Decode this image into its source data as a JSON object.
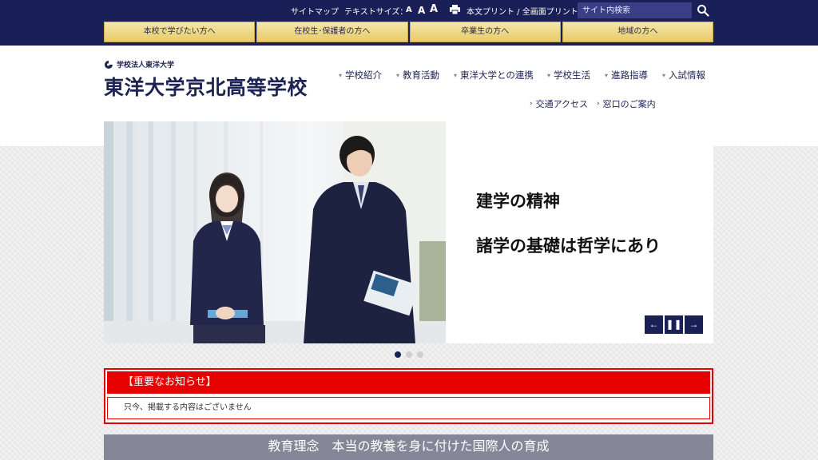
{
  "utility": {
    "sitemap": "サイトマップ",
    "text_size_label": "テキストサイズ：",
    "font_sizes": [
      "A",
      "A",
      "A"
    ],
    "print_label": "本文プリント / 全画面プリント",
    "search_placeholder": "サイト内検索"
  },
  "audience_nav": [
    "本校で学びたい方へ",
    "在校生･保護者の方へ",
    "卒業生の方へ",
    "地域の方へ"
  ],
  "header": {
    "corporation": "学校法人東洋大学",
    "school_name": "東洋大学京北高等学校"
  },
  "global_nav": [
    "学校紹介",
    "教育活動",
    "東洋大学との連携",
    "学校生活",
    "進路指導",
    "入試情報"
  ],
  "sub_nav": [
    "交通アクセス",
    "窓口のご案内"
  ],
  "slider": {
    "title": "建学の精神",
    "text": "諸学の基礎は哲学にあり",
    "slide_count": 3,
    "active_index": 0
  },
  "notice": {
    "heading": "【重要なお知らせ】",
    "body": "只今、掲載する内容はございません"
  },
  "philosophy": "教育理念　本当の教養を身に付けた国際人の育成",
  "colors": {
    "navy": "#1b1f57",
    "gold": "#e6cc6a",
    "alert_red": "#e60000"
  }
}
